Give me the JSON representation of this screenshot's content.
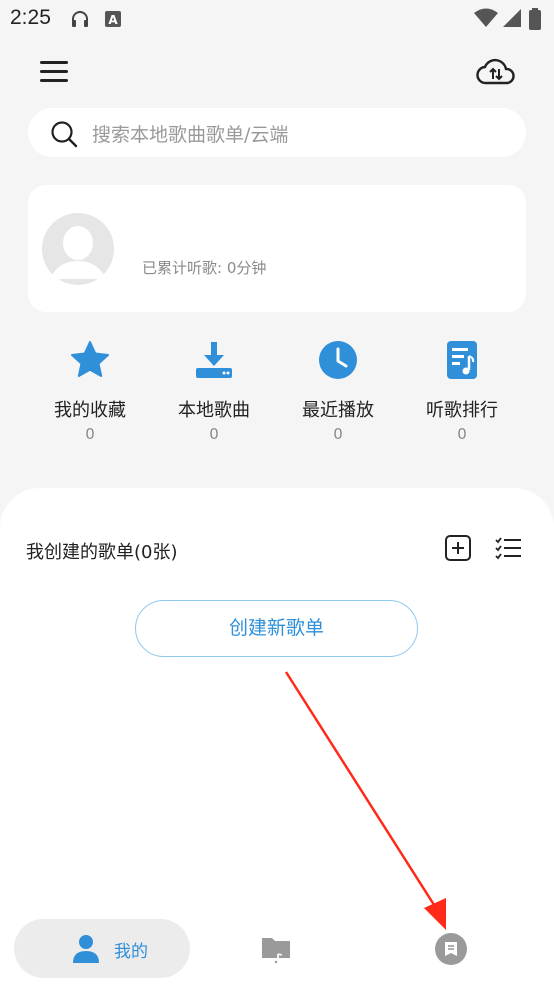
{
  "status_bar": {
    "time": "2:25",
    "icons": [
      "headphones-icon",
      "text-a-icon",
      "wifi-icon",
      "signal-icon"
    ]
  },
  "top_bar": {
    "menu_icon": "hamburger-menu-icon",
    "cloud_icon": "cloud-sync-icon"
  },
  "search": {
    "placeholder": "搜索本地歌曲歌单/云端",
    "icon": "search-icon"
  },
  "profile": {
    "avatar_icon": "default-avatar-icon",
    "listen_time": "已累计听歌: 0分钟"
  },
  "quick_actions": [
    {
      "label": "我的收藏",
      "count": "0",
      "icon": "star-icon"
    },
    {
      "label": "本地歌曲",
      "count": "0",
      "icon": "download-icon"
    },
    {
      "label": "最近播放",
      "count": "0",
      "icon": "clock-icon"
    },
    {
      "label": "听歌排行",
      "count": "0",
      "icon": "music-list-icon"
    }
  ],
  "playlists": {
    "title": "我创建的歌单(0张)",
    "add_icon": "plus-square-icon",
    "manage_icon": "checklist-icon",
    "create_label": "创建新歌单"
  },
  "bottom_nav": {
    "items": [
      {
        "label": "我的",
        "icon": "person-icon",
        "active": true
      },
      {
        "label": "",
        "icon": "music-folder-icon",
        "active": false
      },
      {
        "label": "",
        "icon": "message-icon",
        "active": false
      }
    ]
  },
  "colors": {
    "accent": "#2f8fd8",
    "background": "#f5f5f5",
    "annotation_arrow": "#ff2a1a"
  }
}
